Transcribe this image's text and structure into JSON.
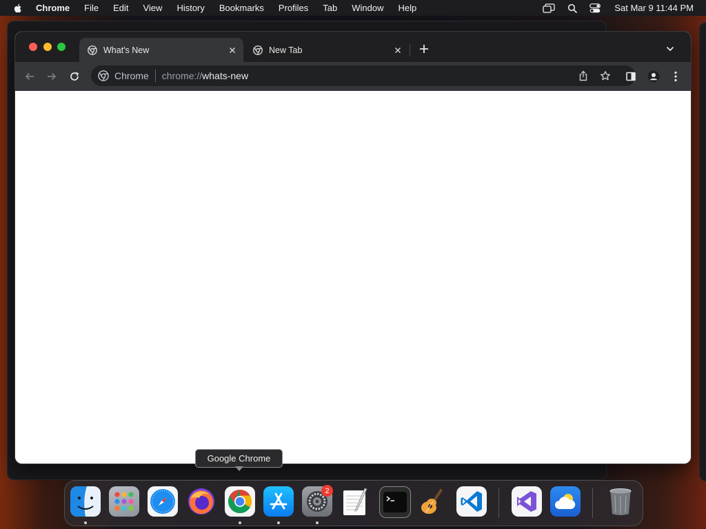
{
  "menubar": {
    "app_name": "Chrome",
    "items": [
      "File",
      "Edit",
      "View",
      "History",
      "Bookmarks",
      "Profiles",
      "Tab",
      "Window",
      "Help"
    ],
    "clock": "Sat Mar 9  11:44 PM"
  },
  "browser": {
    "tabs": [
      {
        "title": "What's New",
        "active": true
      },
      {
        "title": "New Tab",
        "active": false
      }
    ],
    "omnibox": {
      "chip": "Chrome",
      "url_scheme": "chrome://",
      "url_host": "whats-new"
    }
  },
  "tooltip": {
    "text": "Google Chrome"
  },
  "dock": {
    "apps": [
      "finder",
      "launchpad",
      "safari",
      "firefox",
      "google-chrome",
      "app-store",
      "system-settings",
      "textedit",
      "terminal",
      "garageband",
      "visual-studio-code",
      "visual-studio",
      "weather",
      "trash"
    ],
    "settings_badge": "2"
  },
  "colors": {
    "tabstrip": "#1f1f21",
    "toolbar": "#35363a",
    "omnibox": "#202124",
    "close": "#ff5f57",
    "minimize": "#febc2e",
    "maximize": "#28c840"
  }
}
